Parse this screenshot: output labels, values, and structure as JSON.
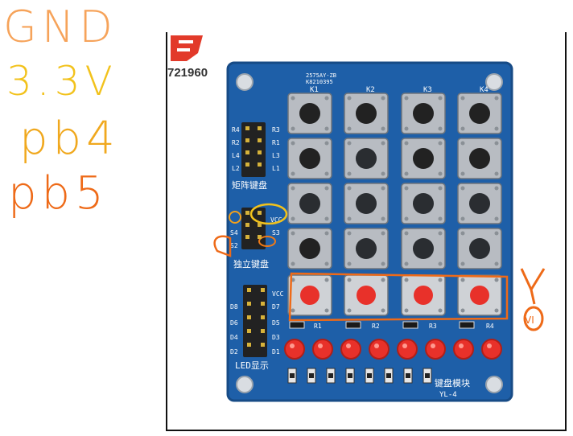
{
  "notes": {
    "line1": "GND",
    "line2": "3.3V",
    "line3": "pb4",
    "line4": "pb5",
    "side_mark": "VI"
  },
  "board": {
    "brand_text": "721960",
    "top_label1": "2575AY-ZB",
    "top_label2": "K8210395",
    "key_labels": [
      "K1",
      "K2",
      "K3",
      "K4"
    ],
    "matrix_pins": [
      "R4",
      "R2",
      "L4",
      "L2",
      "R3",
      "R1",
      "L3",
      "L1"
    ],
    "matrix_title": "矩阵键盘",
    "indep_pins": [
      "VCC",
      "S4",
      "S2",
      "S3"
    ],
    "indep_title": "独立键盘",
    "led_pins": [
      "VCC",
      "D8",
      "D7",
      "D6",
      "D5",
      "D4",
      "D3",
      "D2",
      "D1"
    ],
    "led_title": "LED显示",
    "resistor_labels": [
      "R1",
      "R2",
      "R3",
      "R4"
    ],
    "module_name": "键盘模块",
    "module_id": "YL-4"
  },
  "colors": {
    "pcb_blue": "#1e5fa8",
    "note_orange": "#f08a2a",
    "note_yellow": "#f2c21c",
    "led_red": "#e8312a"
  }
}
